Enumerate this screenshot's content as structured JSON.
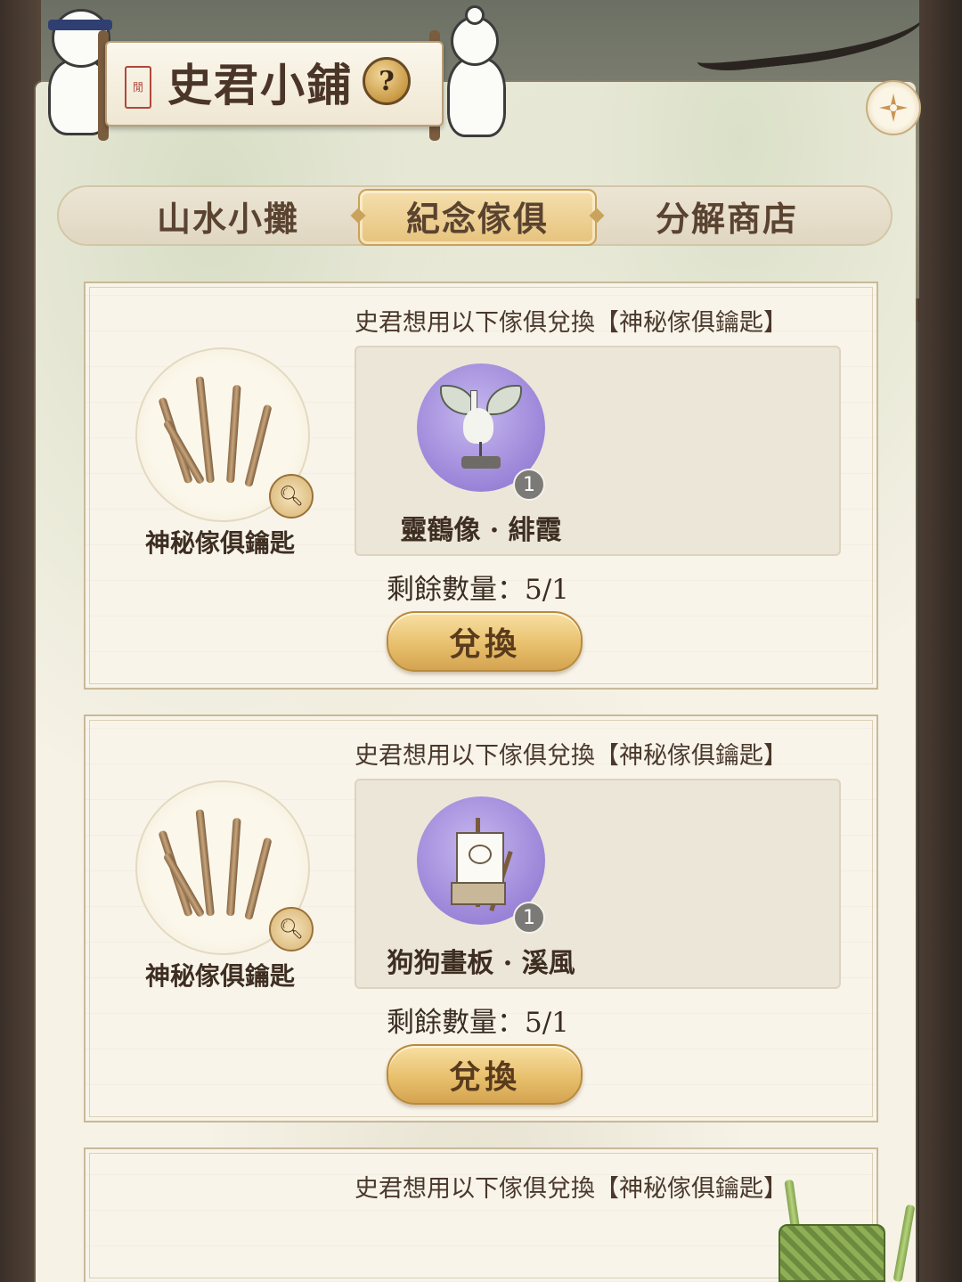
{
  "header": {
    "title": "史君小鋪",
    "seal_text": "閒",
    "help_icon_glyph": "?",
    "close_icon": "compass-close-icon"
  },
  "tabs": [
    {
      "label": "山水小攤",
      "active": false
    },
    {
      "label": "紀念傢俱",
      "active": true
    },
    {
      "label": "分解商店",
      "active": false
    }
  ],
  "cards": [
    {
      "description": "史君想用以下傢俱兌換【神秘傢俱鑰匙】",
      "reward_name": "神秘傢俱鑰匙",
      "required_item": {
        "name": "靈鶴像 · 緋霞",
        "count": "1",
        "icon": "crane-statue-icon"
      },
      "remaining": "剩餘數量：5/1",
      "button": "兌換"
    },
    {
      "description": "史君想用以下傢俱兌換【神秘傢俱鑰匙】",
      "reward_name": "神秘傢俱鑰匙",
      "required_item": {
        "name": "狗狗畫板 · 溪風",
        "count": "1",
        "icon": "dog-easel-icon"
      },
      "remaining": "剩餘數量：5/1",
      "button": "兌換"
    },
    {
      "description": "史君想用以下傢俱兌換【神秘傢俱鑰匙】"
    }
  ],
  "colors": {
    "accent_gold": "#e8c06d",
    "item_bg_purple": "#9a84d8",
    "text_brown": "#4a3528"
  }
}
